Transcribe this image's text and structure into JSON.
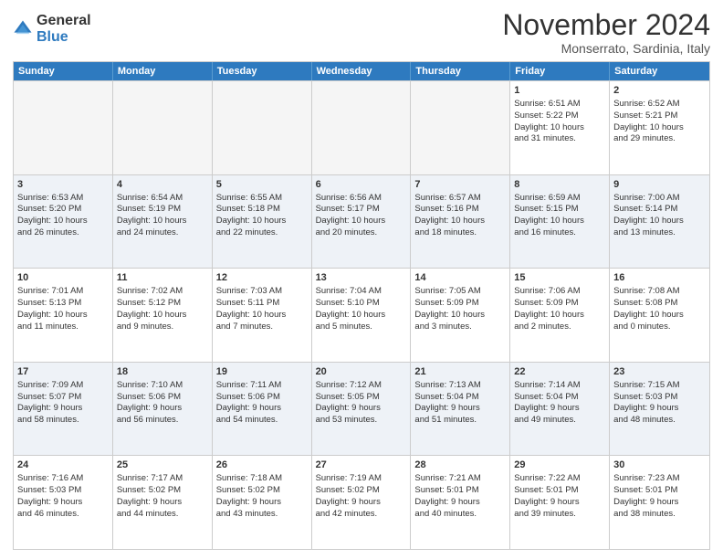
{
  "logo": {
    "general": "General",
    "blue": "Blue"
  },
  "title": "November 2024",
  "subtitle": "Monserrato, Sardinia, Italy",
  "headers": [
    "Sunday",
    "Monday",
    "Tuesday",
    "Wednesday",
    "Thursday",
    "Friday",
    "Saturday"
  ],
  "rows": [
    [
      {
        "day": "",
        "text": ""
      },
      {
        "day": "",
        "text": ""
      },
      {
        "day": "",
        "text": ""
      },
      {
        "day": "",
        "text": ""
      },
      {
        "day": "",
        "text": ""
      },
      {
        "day": "1",
        "text": "Sunrise: 6:51 AM\nSunset: 5:22 PM\nDaylight: 10 hours\nand 31 minutes."
      },
      {
        "day": "2",
        "text": "Sunrise: 6:52 AM\nSunset: 5:21 PM\nDaylight: 10 hours\nand 29 minutes."
      }
    ],
    [
      {
        "day": "3",
        "text": "Sunrise: 6:53 AM\nSunset: 5:20 PM\nDaylight: 10 hours\nand 26 minutes."
      },
      {
        "day": "4",
        "text": "Sunrise: 6:54 AM\nSunset: 5:19 PM\nDaylight: 10 hours\nand 24 minutes."
      },
      {
        "day": "5",
        "text": "Sunrise: 6:55 AM\nSunset: 5:18 PM\nDaylight: 10 hours\nand 22 minutes."
      },
      {
        "day": "6",
        "text": "Sunrise: 6:56 AM\nSunset: 5:17 PM\nDaylight: 10 hours\nand 20 minutes."
      },
      {
        "day": "7",
        "text": "Sunrise: 6:57 AM\nSunset: 5:16 PM\nDaylight: 10 hours\nand 18 minutes."
      },
      {
        "day": "8",
        "text": "Sunrise: 6:59 AM\nSunset: 5:15 PM\nDaylight: 10 hours\nand 16 minutes."
      },
      {
        "day": "9",
        "text": "Sunrise: 7:00 AM\nSunset: 5:14 PM\nDaylight: 10 hours\nand 13 minutes."
      }
    ],
    [
      {
        "day": "10",
        "text": "Sunrise: 7:01 AM\nSunset: 5:13 PM\nDaylight: 10 hours\nand 11 minutes."
      },
      {
        "day": "11",
        "text": "Sunrise: 7:02 AM\nSunset: 5:12 PM\nDaylight: 10 hours\nand 9 minutes."
      },
      {
        "day": "12",
        "text": "Sunrise: 7:03 AM\nSunset: 5:11 PM\nDaylight: 10 hours\nand 7 minutes."
      },
      {
        "day": "13",
        "text": "Sunrise: 7:04 AM\nSunset: 5:10 PM\nDaylight: 10 hours\nand 5 minutes."
      },
      {
        "day": "14",
        "text": "Sunrise: 7:05 AM\nSunset: 5:09 PM\nDaylight: 10 hours\nand 3 minutes."
      },
      {
        "day": "15",
        "text": "Sunrise: 7:06 AM\nSunset: 5:09 PM\nDaylight: 10 hours\nand 2 minutes."
      },
      {
        "day": "16",
        "text": "Sunrise: 7:08 AM\nSunset: 5:08 PM\nDaylight: 10 hours\nand 0 minutes."
      }
    ],
    [
      {
        "day": "17",
        "text": "Sunrise: 7:09 AM\nSunset: 5:07 PM\nDaylight: 9 hours\nand 58 minutes."
      },
      {
        "day": "18",
        "text": "Sunrise: 7:10 AM\nSunset: 5:06 PM\nDaylight: 9 hours\nand 56 minutes."
      },
      {
        "day": "19",
        "text": "Sunrise: 7:11 AM\nSunset: 5:06 PM\nDaylight: 9 hours\nand 54 minutes."
      },
      {
        "day": "20",
        "text": "Sunrise: 7:12 AM\nSunset: 5:05 PM\nDaylight: 9 hours\nand 53 minutes."
      },
      {
        "day": "21",
        "text": "Sunrise: 7:13 AM\nSunset: 5:04 PM\nDaylight: 9 hours\nand 51 minutes."
      },
      {
        "day": "22",
        "text": "Sunrise: 7:14 AM\nSunset: 5:04 PM\nDaylight: 9 hours\nand 49 minutes."
      },
      {
        "day": "23",
        "text": "Sunrise: 7:15 AM\nSunset: 5:03 PM\nDaylight: 9 hours\nand 48 minutes."
      }
    ],
    [
      {
        "day": "24",
        "text": "Sunrise: 7:16 AM\nSunset: 5:03 PM\nDaylight: 9 hours\nand 46 minutes."
      },
      {
        "day": "25",
        "text": "Sunrise: 7:17 AM\nSunset: 5:02 PM\nDaylight: 9 hours\nand 44 minutes."
      },
      {
        "day": "26",
        "text": "Sunrise: 7:18 AM\nSunset: 5:02 PM\nDaylight: 9 hours\nand 43 minutes."
      },
      {
        "day": "27",
        "text": "Sunrise: 7:19 AM\nSunset: 5:02 PM\nDaylight: 9 hours\nand 42 minutes."
      },
      {
        "day": "28",
        "text": "Sunrise: 7:21 AM\nSunset: 5:01 PM\nDaylight: 9 hours\nand 40 minutes."
      },
      {
        "day": "29",
        "text": "Sunrise: 7:22 AM\nSunset: 5:01 PM\nDaylight: 9 hours\nand 39 minutes."
      },
      {
        "day": "30",
        "text": "Sunrise: 7:23 AM\nSunset: 5:01 PM\nDaylight: 9 hours\nand 38 minutes."
      }
    ]
  ]
}
